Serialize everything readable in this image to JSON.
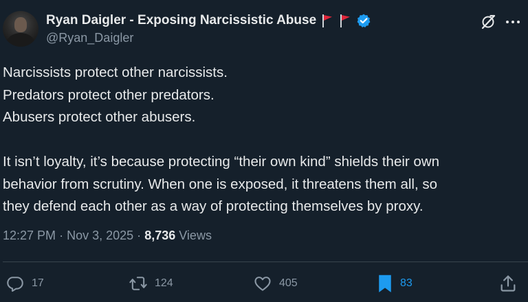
{
  "author": {
    "display_name": "Ryan Daigler - Exposing Narcissistic Abuse",
    "handle": "@Ryan_Daigler",
    "flag_emoji_count": 2,
    "verified": true
  },
  "tweet": {
    "lines": [
      "Narcissists protect other narcissists.",
      "Predators protect other predators.",
      "Abusers protect other abusers.",
      "",
      "It isn’t loyalty, it’s because protecting “their own kind” shields their own",
      "behavior from scrutiny. When one is exposed, it threatens them all, so",
      "they defend each other as a way of protecting themselves by proxy."
    ]
  },
  "meta": {
    "time": "12:27 PM",
    "separator": "·",
    "date": "Nov 3, 2025",
    "views_count": "8,736",
    "views_label": "Views"
  },
  "actions": {
    "reply_count": "17",
    "retweet_count": "124",
    "like_count": "405",
    "bookmark_count": "83"
  },
  "colors": {
    "background": "#15202b",
    "text_primary": "#e7e9ea",
    "text_secondary": "#8b98a5",
    "accent": "#1d9bf0",
    "divider": "#38444d",
    "flag_red": "#e0263a"
  },
  "icons": {
    "header": [
      "grok-icon",
      "more-icon"
    ],
    "actions": [
      "reply-icon",
      "retweet-icon",
      "like-icon",
      "bookmark-icon",
      "share-icon"
    ]
  }
}
